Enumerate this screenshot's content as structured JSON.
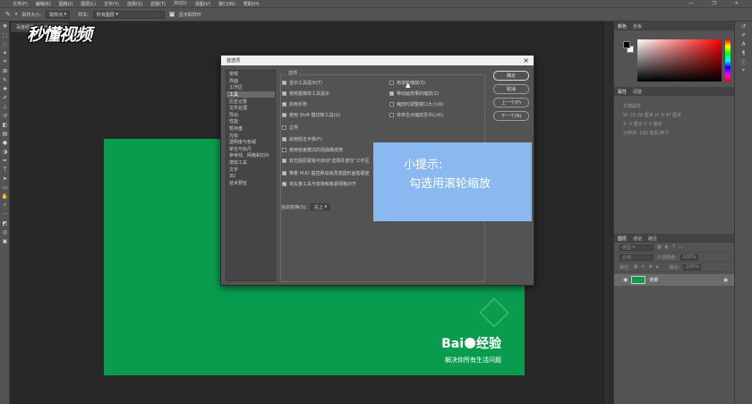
{
  "menubar": {
    "items": [
      "文件(F)",
      "编辑(E)",
      "图像(I)",
      "图层(L)",
      "文字(Y)",
      "选择(S)",
      "滤镜(T)",
      "3D(D)",
      "视图(V)",
      "窗口(W)",
      "帮助(H)"
    ],
    "minimize": "—",
    "restore": "❐",
    "close": "✕"
  },
  "options_bar": {
    "brush_size_label": "取样大小:",
    "brush_size_value": "取样点",
    "sample_label": "样本:",
    "sample_value": "所有图层",
    "show_ring_label": "显示取样环"
  },
  "document": {
    "tab_title": "百度经验.jpg @ 33.3%",
    "watermark": "秒懂视频"
  },
  "canvas": {
    "logo": "Bai经验",
    "logo_left": "Bai",
    "logo_right": "经验",
    "slogan": "解决你所有生活问题",
    "color": "#0a9c4e"
  },
  "right_panel": {
    "color_tabs": [
      "颜色",
      "色板"
    ],
    "props_tabs": [
      "属性",
      "调整"
    ],
    "props_rows": [
      "文档属性",
      "W: 25.26 厘米    H: 8.47 厘米",
      "X: 0 厘米    Y: 0 厘米",
      "分辨率: 180 像素/英寸"
    ],
    "layers_tabs": [
      "图层",
      "通道",
      "路径"
    ],
    "layer_kind_label": "类型",
    "blend_mode": "正常",
    "opacity_label": "不透明度:",
    "opacity_value": "100%",
    "lock_label": "锁定:",
    "fill_label": "填充:",
    "fill_value": "100%",
    "layer_name": "背景"
  },
  "prefs_dialog": {
    "title": "首选项",
    "nav_items": [
      "常规",
      "界面",
      "工作区",
      "工具",
      "历史记录",
      "文件处理",
      "导出",
      "性能",
      "暂存盘",
      "光标",
      "透明度与色域",
      "单位与标尺",
      "参考线、网格和切片",
      "增效工具",
      "文字",
      "3D",
      "技术预览"
    ],
    "selected_nav": "工具",
    "options_label": "选项",
    "left_options": [
      {
        "label": "显示工具提示(T)",
        "checked": true
      },
      {
        "label": "使用富媒体工具提示",
        "checked": true
      },
      {
        "label": "启用手势",
        "checked": true
      },
      {
        "label": "使用 Shift 键切换工具(U)",
        "checked": true
      },
      {
        "label": "过界",
        "checked": false
      },
      {
        "label": "启用轻击平移(F)",
        "checked": true
      },
      {
        "label": "使用容差模式的扭曲橡皮擦",
        "checked": false
      },
      {
        "label": "双击图层蒙版可启动\"选择并遮住\"工作区",
        "checked": true
      },
      {
        "label": "带着 HUD 垂直移动来改变圆形画笔硬度",
        "checked": true
      },
      {
        "label": "将矢量工具与变换和像素网格对齐",
        "checked": true
      }
    ],
    "right_options": [
      {
        "label": "用滚轮缩放(S)",
        "checked": false
      },
      {
        "label": "带动画效果的缩放(Z)",
        "checked": true
      },
      {
        "label": "缩放时调整窗口大小(R)",
        "checked": false
      },
      {
        "label": "将单击点缩放至中心(K)",
        "checked": false
      }
    ],
    "reset_label": "自由变换(V):",
    "reset_value": "右上",
    "buttons": {
      "ok": "确定",
      "cancel": "取消",
      "prev": "上一个(P)",
      "next": "下一个(N)"
    }
  },
  "tip": {
    "title": "小提示:",
    "body": "勾选用滚轮缩放",
    "color": "#8ab9f1"
  }
}
